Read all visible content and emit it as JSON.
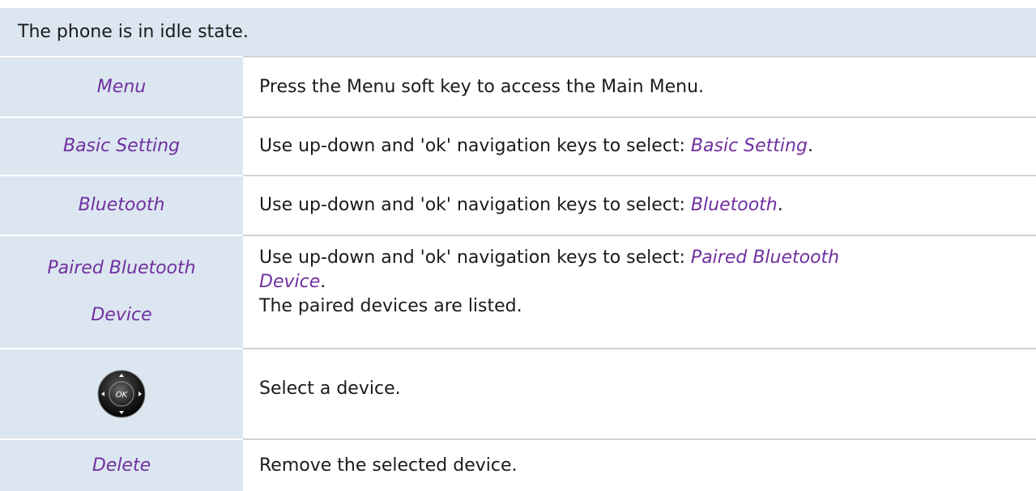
{
  "header": {
    "text": "The phone is in idle state."
  },
  "rows": [
    {
      "key": "Menu",
      "desc": "Press the Menu soft key to access the Main Menu."
    },
    {
      "key": "Basic Setting",
      "desc_prefix": "Use up-down and 'ok' navigation keys to select: ",
      "desc_link": "Basic Setting",
      "desc_suffix": "."
    },
    {
      "key": "Bluetooth",
      "desc_prefix": "Use up-down and 'ok' navigation keys to select: ",
      "desc_link": "Bluetooth",
      "desc_suffix": "."
    },
    {
      "key_line1": "Paired Bluetooth",
      "key_line2": "Device",
      "desc_prefix": "Use up-down and 'ok' navigation keys to select: ",
      "desc_link_line1": "Paired Bluetooth",
      "desc_link_line2": "Device",
      "desc_suffix": ".",
      "desc_extra": "The paired devices are listed."
    },
    {
      "key_icon": "ok-navigation-key-icon",
      "key_icon_label": "OK",
      "desc": "Select a device."
    },
    {
      "key": "Delete",
      "desc": "Remove the selected device."
    }
  ],
  "colors": {
    "left_cell_bg": "#dce6f1",
    "keyword": "#7030a0",
    "text": "#1a1a1a",
    "divider": "#d3d3d3"
  }
}
